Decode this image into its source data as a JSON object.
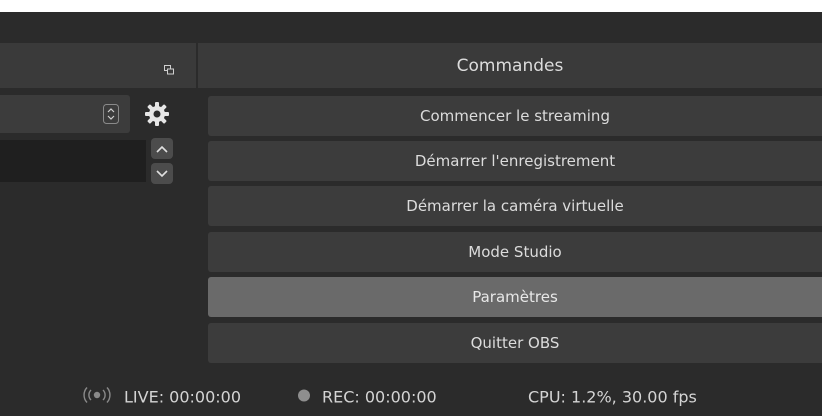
{
  "controls_dock": {
    "title": "Commandes",
    "buttons": [
      {
        "label": "Commencer le streaming"
      },
      {
        "label": "Démarrer l'enregistrement"
      },
      {
        "label": "Démarrer la caméra virtuelle"
      },
      {
        "label": "Mode Studio"
      },
      {
        "label": "Paramètres",
        "state": "hover"
      },
      {
        "label": "Quitter OBS"
      }
    ]
  },
  "left_dock": {
    "icons": [
      "float-dock-icon",
      "combo-arrows-icon",
      "gear-icon",
      "spin-up-icon",
      "spin-down-icon"
    ]
  },
  "statusbar": {
    "live": "LIVE: 00:00:00",
    "rec": "REC: 00:00:00",
    "cpu": "CPU: 1.2%, 30.00 fps"
  },
  "colors": {
    "panel": "#3a3a3a",
    "button": "#3c3c3c",
    "button_hover": "#6a6a6a",
    "background": "#2b2b2b"
  }
}
